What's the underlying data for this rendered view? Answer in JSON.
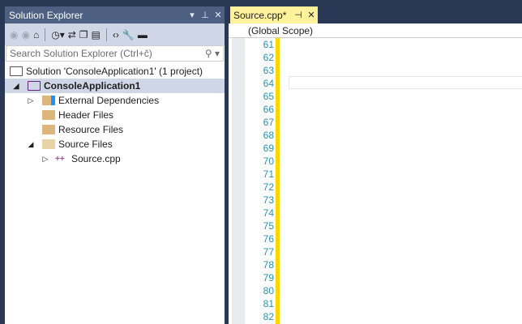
{
  "solution_explorer": {
    "title": "Solution Explorer",
    "search_placeholder": "Search Solution Explorer (Ctrl+č)",
    "tree": [
      {
        "label": "Solution 'ConsoleApplication1' (1 project)"
      },
      {
        "label": "ConsoleApplication1"
      },
      {
        "label": "External Dependencies"
      },
      {
        "label": "Header Files"
      },
      {
        "label": "Resource Files"
      },
      {
        "label": "Source Files"
      },
      {
        "label": "Source.cpp"
      }
    ]
  },
  "editor": {
    "tab_label": "Source.cpp*",
    "scope": "(Global Scope)",
    "line_numbers": [
      "61",
      "62",
      "63",
      "64",
      "65",
      "66",
      "67",
      "68",
      "69",
      "70",
      "71",
      "72",
      "73",
      "74",
      "75",
      "76",
      "77",
      "78",
      "79",
      "80",
      "81",
      "82"
    ]
  }
}
